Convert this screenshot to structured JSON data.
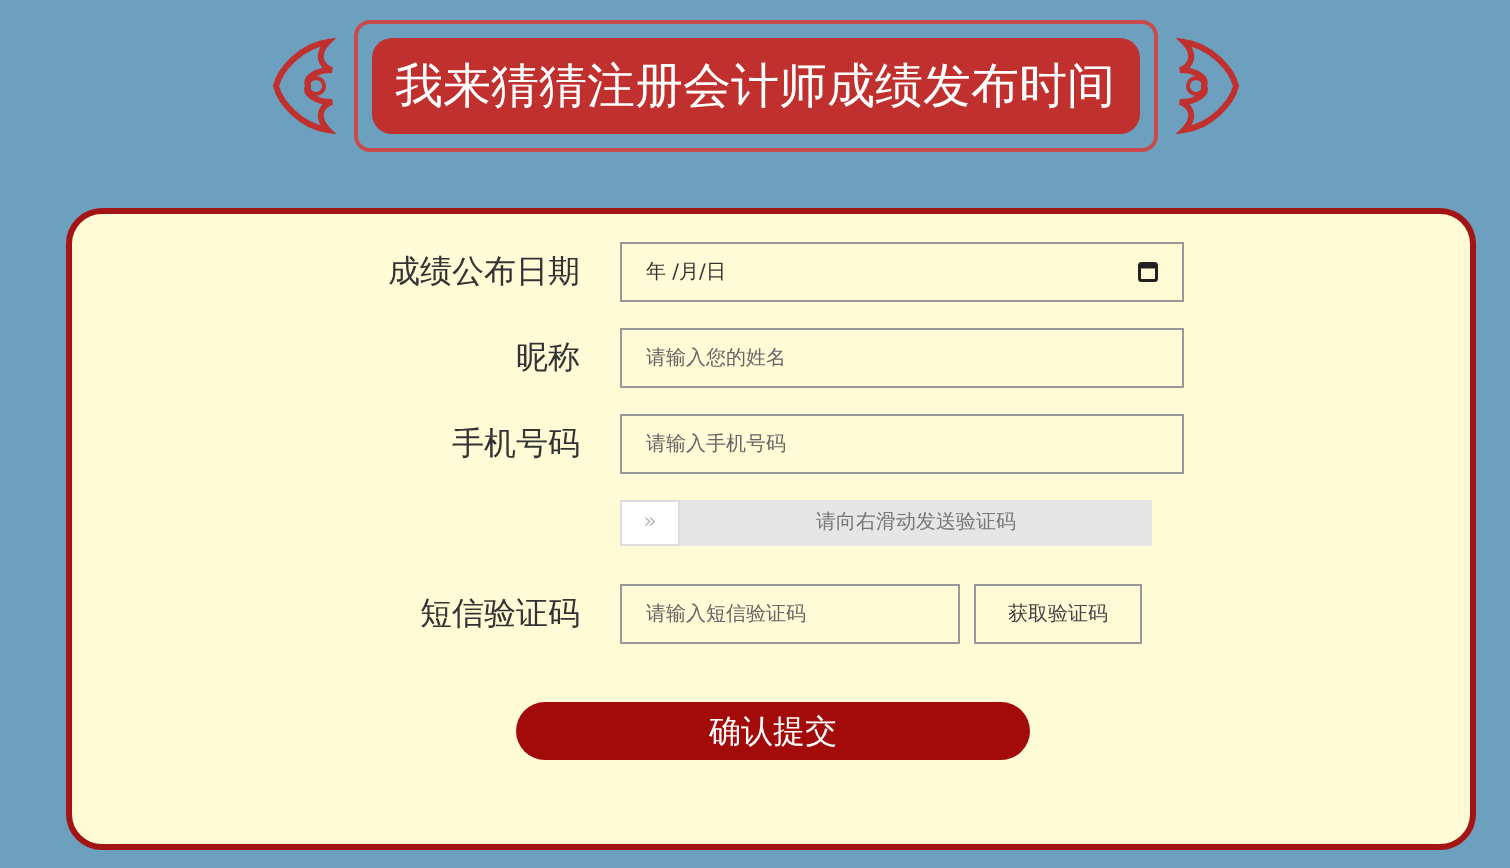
{
  "banner": {
    "title": "我来猜猜注册会计师成绩发布时间"
  },
  "form": {
    "fields": [
      {
        "kind": "date",
        "label": "成绩公布日期",
        "value": "年 /月/日"
      },
      {
        "kind": "text",
        "label": "昵称",
        "placeholder": "请输入您的姓名"
      },
      {
        "kind": "text",
        "label": "手机号码",
        "placeholder": "请输入手机号码"
      },
      {
        "kind": "slider",
        "handle": "»",
        "hint": "请向右滑动发送验证码"
      },
      {
        "kind": "code",
        "label": "短信验证码",
        "placeholder": "请输入短信验证码",
        "button": "获取验证码"
      }
    ],
    "submit": "确认提交"
  }
}
